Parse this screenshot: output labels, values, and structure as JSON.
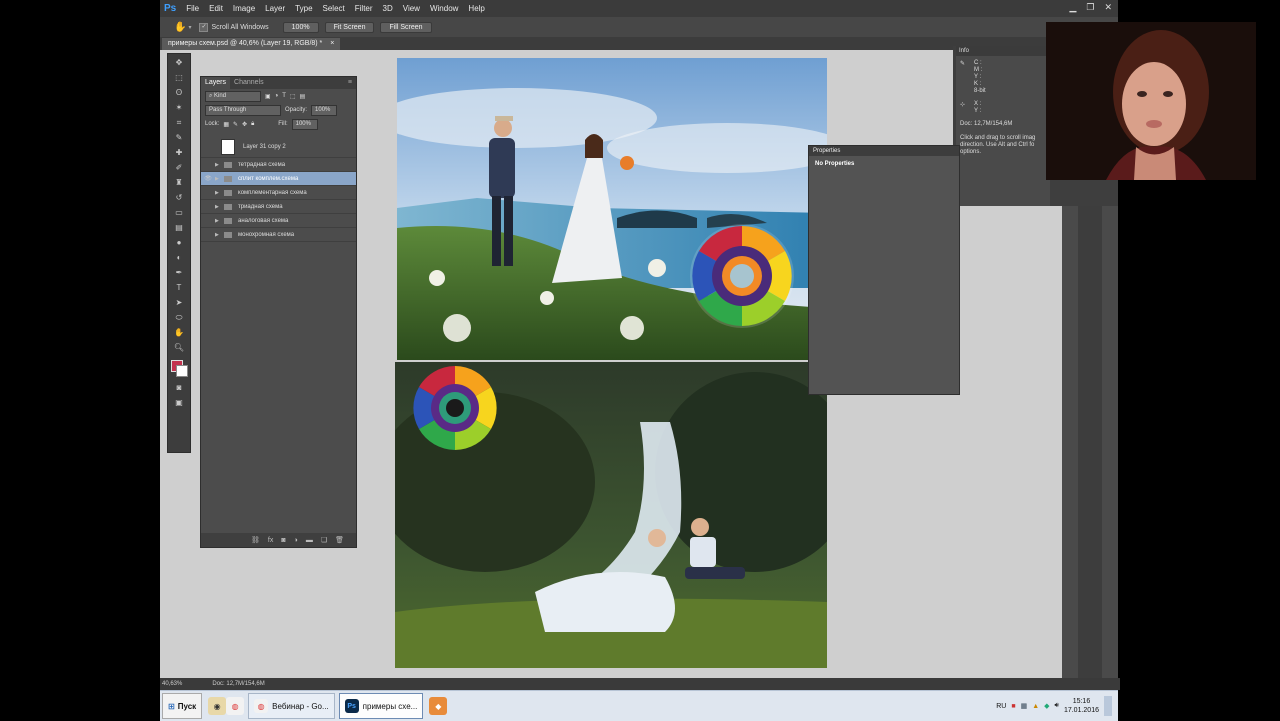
{
  "ps": {
    "logo": "Ps",
    "menu": [
      "File",
      "Edit",
      "Image",
      "Layer",
      "Type",
      "Select",
      "Filter",
      "3D",
      "View",
      "Window",
      "Help"
    ],
    "options": {
      "scroll_all_windows": "Scroll All Windows",
      "zoom_100": "100%",
      "fit_screen": "Fit Screen",
      "fill_screen": "Fill Screen"
    },
    "doc_tab": "примеры схем.psd @ 40,6% (Layer 19, RGB/8) *",
    "doc_tab_close": "×",
    "status": {
      "zoom": "40,63%",
      "doc": "Doc: 12,7M/154,6M"
    }
  },
  "layers": {
    "tabs": [
      "Layers",
      "Channels"
    ],
    "kind": "Kind",
    "blend": "Pass Through",
    "opacity_label": "Opacity:",
    "opacity_value": "100%",
    "lock_label": "Lock:",
    "fill_label": "Fill:",
    "fill_value": "100%",
    "top_layer": "Layer 31 copy 2",
    "groups": [
      "тетрадная схема",
      "сплит комплем.схема",
      "комплементарная схема",
      "триадная схема",
      "аналоговая схема",
      "монохромная схема"
    ]
  },
  "properties": {
    "title": "Properties",
    "body": "No Properties"
  },
  "info": {
    "title": "Info",
    "cmyk": [
      "C :",
      "M :",
      "Y :",
      "K :"
    ],
    "bit": "8-bit",
    "xy": [
      "X :",
      "Y :"
    ],
    "doc": "Doc: 12,7M/154,6M",
    "hint": "Click and drag to scroll imag direction. Use Alt and Ctrl fo options."
  },
  "taskbar": {
    "start": "Пуск",
    "tasks": [
      "Вебинар - Go...",
      "примеры схе..."
    ],
    "lang": "RU",
    "time": "15:16",
    "date": "17.01.2016"
  }
}
